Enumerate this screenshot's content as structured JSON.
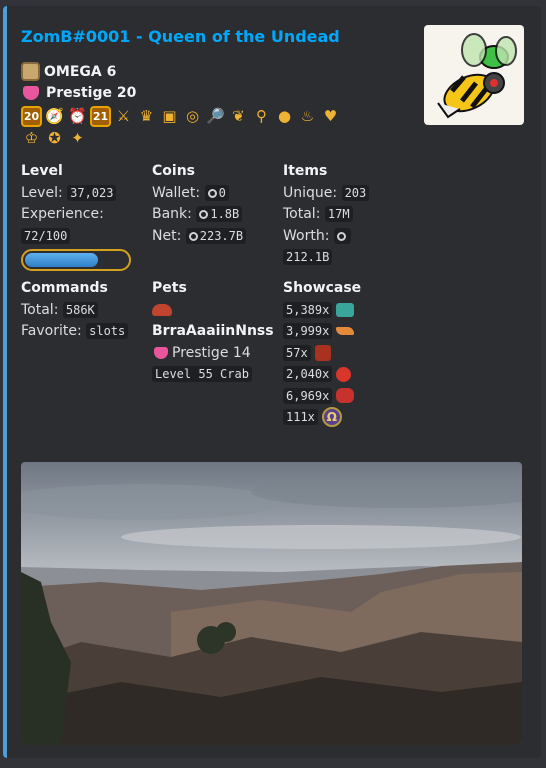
{
  "title": "ZomB#0001 - Queen of the Undead",
  "rank": {
    "label": "OMEGA 6",
    "icon": "omega-badge-icon"
  },
  "prestige": {
    "label": "Prestige 20",
    "icon": "prestige-icon"
  },
  "badges": [
    "20",
    "compass",
    "alarm",
    "21",
    "swords",
    "crown",
    "chest",
    "coin-swirl",
    "magnifier",
    "hearts",
    "lens",
    "apple",
    "money-bag",
    "heart-badge",
    "trophy-pot",
    "compass-2",
    "rocket"
  ],
  "level": {
    "heading": "Level",
    "level_label": "Level:",
    "level_value": "37,023",
    "exp_label": "Experience:",
    "exp_value": "72/100",
    "exp_fraction": 0.72
  },
  "coins": {
    "heading": "Coins",
    "wallet_label": "Wallet:",
    "wallet_value": "0",
    "bank_label": "Bank:",
    "bank_value": "1.8B",
    "net_label": "Net:",
    "net_value": "223.7B"
  },
  "items": {
    "heading": "Items",
    "unique_label": "Unique:",
    "unique_value": "203",
    "total_label": "Total:",
    "total_value": "17M",
    "worth_label": "Worth:",
    "worth_value": "212.1B"
  },
  "commands": {
    "heading": "Commands",
    "total_label": "Total:",
    "total_value": "586K",
    "favorite_label": "Favorite:",
    "favorite_value": "slots"
  },
  "pets": {
    "heading": "Pets",
    "name": "BrraAaaiinNnss",
    "prestige_label": "Prestige 14",
    "level_label": "Level 55 Crab"
  },
  "showcase": {
    "heading": "Showcase",
    "items": [
      {
        "count": "5,389x",
        "icon": "treasure-chest-icon",
        "color": "#3aa59a"
      },
      {
        "count": "3,999x",
        "icon": "pizza-icon",
        "color": "#e58a3a"
      },
      {
        "count": "57x",
        "icon": "dragon-icon",
        "color": "#a8321f"
      },
      {
        "count": "2,040x",
        "icon": "tomato-icon",
        "color": "#d9352b"
      },
      {
        "count": "6,969x",
        "icon": "rose-icon",
        "color": "#c8322e"
      },
      {
        "count": "111x",
        "icon": "omega-coin-icon",
        "color": "#b49b3d"
      }
    ]
  },
  "colors": {
    "title": "#00a8fc",
    "accent_bar": "#4f9ed6",
    "embed_bg": "#2b2d31"
  }
}
